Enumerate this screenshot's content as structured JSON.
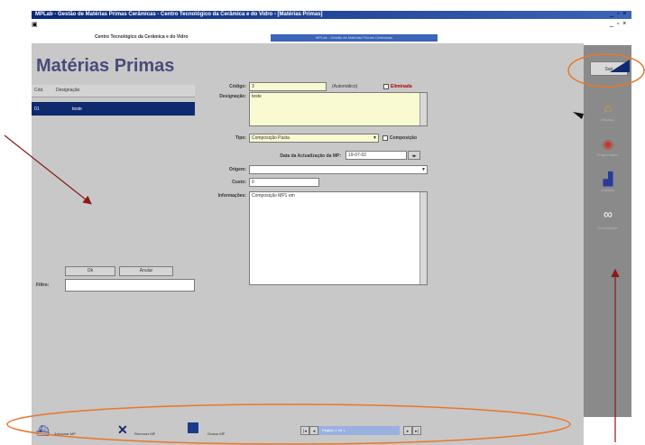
{
  "window": {
    "title": "MPLab - Gestão de Matérias Primas Cerâmicas - Centro Tecnológico da Cerâmica e do Vidro - [Matérias Primas]",
    "controls": "_ ▫ ×",
    "menu_icon": "app-menu-icon"
  },
  "header": {
    "company": "Centro Tecnológico da Cerâmica e do Vidro",
    "strip": "MPLab - Gestão de Matérias Primas Cerâmicas"
  },
  "page": {
    "title": "Matérias Primas"
  },
  "list": {
    "columns": [
      "Cód.",
      "Designação"
    ],
    "rows": [
      {
        "code": "01",
        "name": "teste"
      }
    ]
  },
  "form": {
    "codigo_label": "Código:",
    "codigo_value": "3",
    "automatico_label": "(Automático)",
    "eliminada_label": "Eliminada",
    "designacao_label": "Designação:",
    "designacao_value": "teste",
    "tipo_label": "Tipo:",
    "tipo_value": "Composição Pasta",
    "composicao_label": "Composição",
    "data_label": "Data da Actualização da MP:",
    "data_value": "19-07-02",
    "origem_label": "Origem:",
    "origem_value": "",
    "custo_label": "Custo:",
    "custo_value": "0",
    "informacoes_label": "Informações:",
    "informacoes_value": "Composição MP1 em"
  },
  "filter": {
    "ok_label": "Ok",
    "anular_label": "Anular",
    "filtro_label": "Filtro:",
    "filtro_value": ""
  },
  "sidebar": {
    "exit_label": "Sair",
    "items": [
      {
        "label": "Ensaios",
        "icon": "house-icon"
      },
      {
        "label": "Propriedades",
        "icon": "disc-icon"
      },
      {
        "label": "Análises",
        "icon": "chart-icon"
      },
      {
        "label": "Composição",
        "icon": "binoculars-icon"
      }
    ]
  },
  "toolbar": {
    "new_label": "Adicionar MP",
    "delete_label": "Remover MP",
    "save_label": "Gravar MP",
    "record_label": "Registo 1 de 1"
  },
  "colors": {
    "annotation": "#e8772a",
    "arrow": "#8b1a1a",
    "selection": "#102a70",
    "title": "#4a4a7a"
  }
}
